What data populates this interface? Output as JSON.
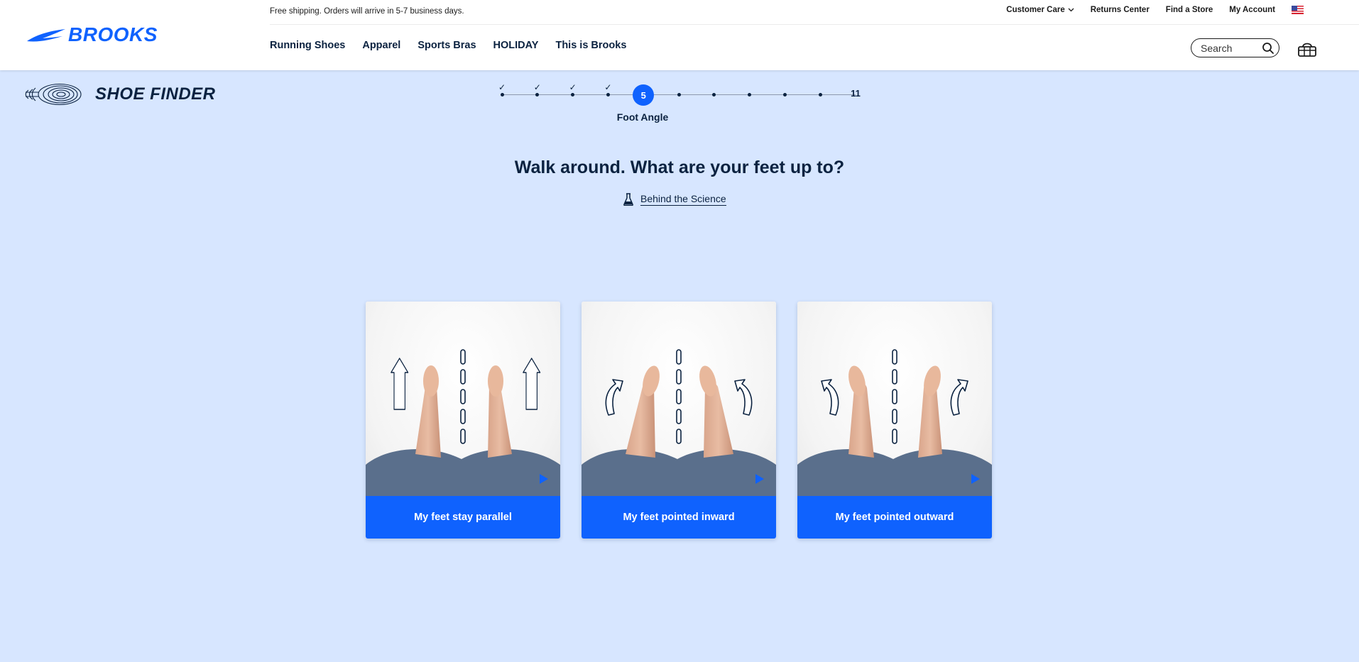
{
  "header": {
    "brand": "BROOKS",
    "promo": "Free shipping. Orders will arrive in 5-7 business days.",
    "utility": [
      {
        "label": "Customer Care"
      },
      {
        "label": "Returns Center"
      },
      {
        "label": "Find a Store"
      },
      {
        "label": "My Account"
      }
    ],
    "nav": [
      {
        "label": "Running Shoes"
      },
      {
        "label": "Apparel"
      },
      {
        "label": "Sports Bras"
      },
      {
        "label": "HOLIDAY"
      },
      {
        "label": "This is Brooks"
      }
    ],
    "search_placeholder": "Search"
  },
  "finder": {
    "title": "SHOE FINDER",
    "current_step": "5",
    "last_step": "11",
    "total_steps": 11,
    "completed_steps": 4,
    "step_label": "Foot Angle"
  },
  "question": {
    "title": "Walk around. What are your feet up to?",
    "science_link": "Behind the Science"
  },
  "options": [
    {
      "label": "My feet stay parallel",
      "icon": "straight-arrows-icon"
    },
    {
      "label": "My feet pointed inward",
      "icon": "inward-arrows-icon"
    },
    {
      "label": "My feet pointed outward",
      "icon": "outward-arrows-icon"
    }
  ],
  "colors": {
    "brand_blue": "#0f62fe",
    "navy": "#0b2240",
    "page_bg": "#d7e6ff"
  }
}
